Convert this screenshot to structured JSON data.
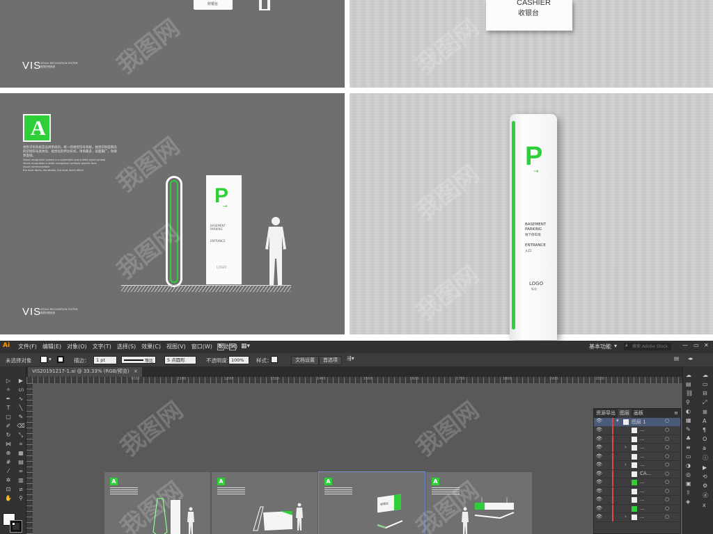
{
  "top_left_panel": {
    "sign_text": "收银台",
    "vis_title": "VIS",
    "vis_sub_en": "VISUAL RECOGNITION SYSTEM",
    "vis_sub_cn": "视觉识别系统"
  },
  "top_right_panel": {
    "sign_en": "CASHIER",
    "sign_cn": "收银台"
  },
  "mid_left_panel": {
    "badge_letter": "A",
    "desc_cn_1": "视觉识别系统是品牌系统的，统一的视觉符号系统。视觉识别是静态",
    "desc_cn_2": "的识别符号具体化、视觉化的传达形式，项目最多，层面最广，效果",
    "desc_cn_3": "更直接。",
    "desc_en_1": "Visual recognition system is a systematic and unified visual symbol",
    "desc_en_2": "Visual recognition is static recognition symbols specific form",
    "desc_en_3": "visual communication",
    "desc_en_4": "the most items, the widest, the most direct effect",
    "parking_letter": "P",
    "parking_arrow": "→",
    "parking_en": "BASEMENT PARKING",
    "parking_entrance": "ENTRANCE",
    "parking_logo": "LOGO",
    "vis_title": "VIS",
    "vis_sub_en": "VISUAL RECOGNITION SYSTEM",
    "vis_sub_cn": "视觉识别系统"
  },
  "mid_right_panel": {
    "parking_letter": "P",
    "parking_arrow": "→",
    "parking_en_1": "BASEMENT",
    "parking_en_2": "PARKING",
    "parking_cn": "地下停车场",
    "entrance_en": "ENTRANCE",
    "entrance_cn": "入口",
    "logo_text": "LOGO",
    "logo_sub": "标志"
  },
  "watermark_text": "我图网",
  "illustrator": {
    "app_icon": "Ai",
    "menu": [
      "文件(F)",
      "编辑(E)",
      "对象(O)",
      "文字(T)",
      "选择(S)",
      "效果(C)",
      "视图(V)",
      "窗口(W)",
      "帮助(H)"
    ],
    "workspace": "基本功能",
    "search_placeholder": "搜索 Adobe Stock",
    "control": {
      "no_selection": "未选择对象",
      "stroke_label": "描边：",
      "stroke_value": "1 pt",
      "profile_label": "等比",
      "brush_value": "5 点圆形",
      "opacity_label": "不透明度：",
      "opacity_value": "100%",
      "style_label": "样式：",
      "doc_setup": "文档设置",
      "prefs": "首选项"
    },
    "doc_tab": "VIS20191217-1.ai @ 33.33% (RGB/预览)",
    "doc_tab_close": "×",
    "ruler_marks": [
      "1000",
      "1100",
      "1200",
      "1300",
      "1400",
      "1500",
      "1600",
      "1700",
      "1800",
      "1900",
      "2000"
    ],
    "panel_tabs": [
      "资源导出",
      "图层",
      "画板"
    ],
    "active_panel_tab": "图层",
    "layer_name": "图层 1",
    "layer_rows": [
      "...",
      "...",
      "...",
      "...",
      "...",
      "CA...",
      "...",
      "...",
      "...",
      "...",
      "..."
    ],
    "artboard_letters": [
      "A",
      "A",
      "A",
      "A"
    ],
    "artboard3_sign_cn": "收银台"
  },
  "colors": {
    "brand_green": "#2fcf3a",
    "panel_gray": "#6f6f6f",
    "ai_dark": "#323232"
  }
}
